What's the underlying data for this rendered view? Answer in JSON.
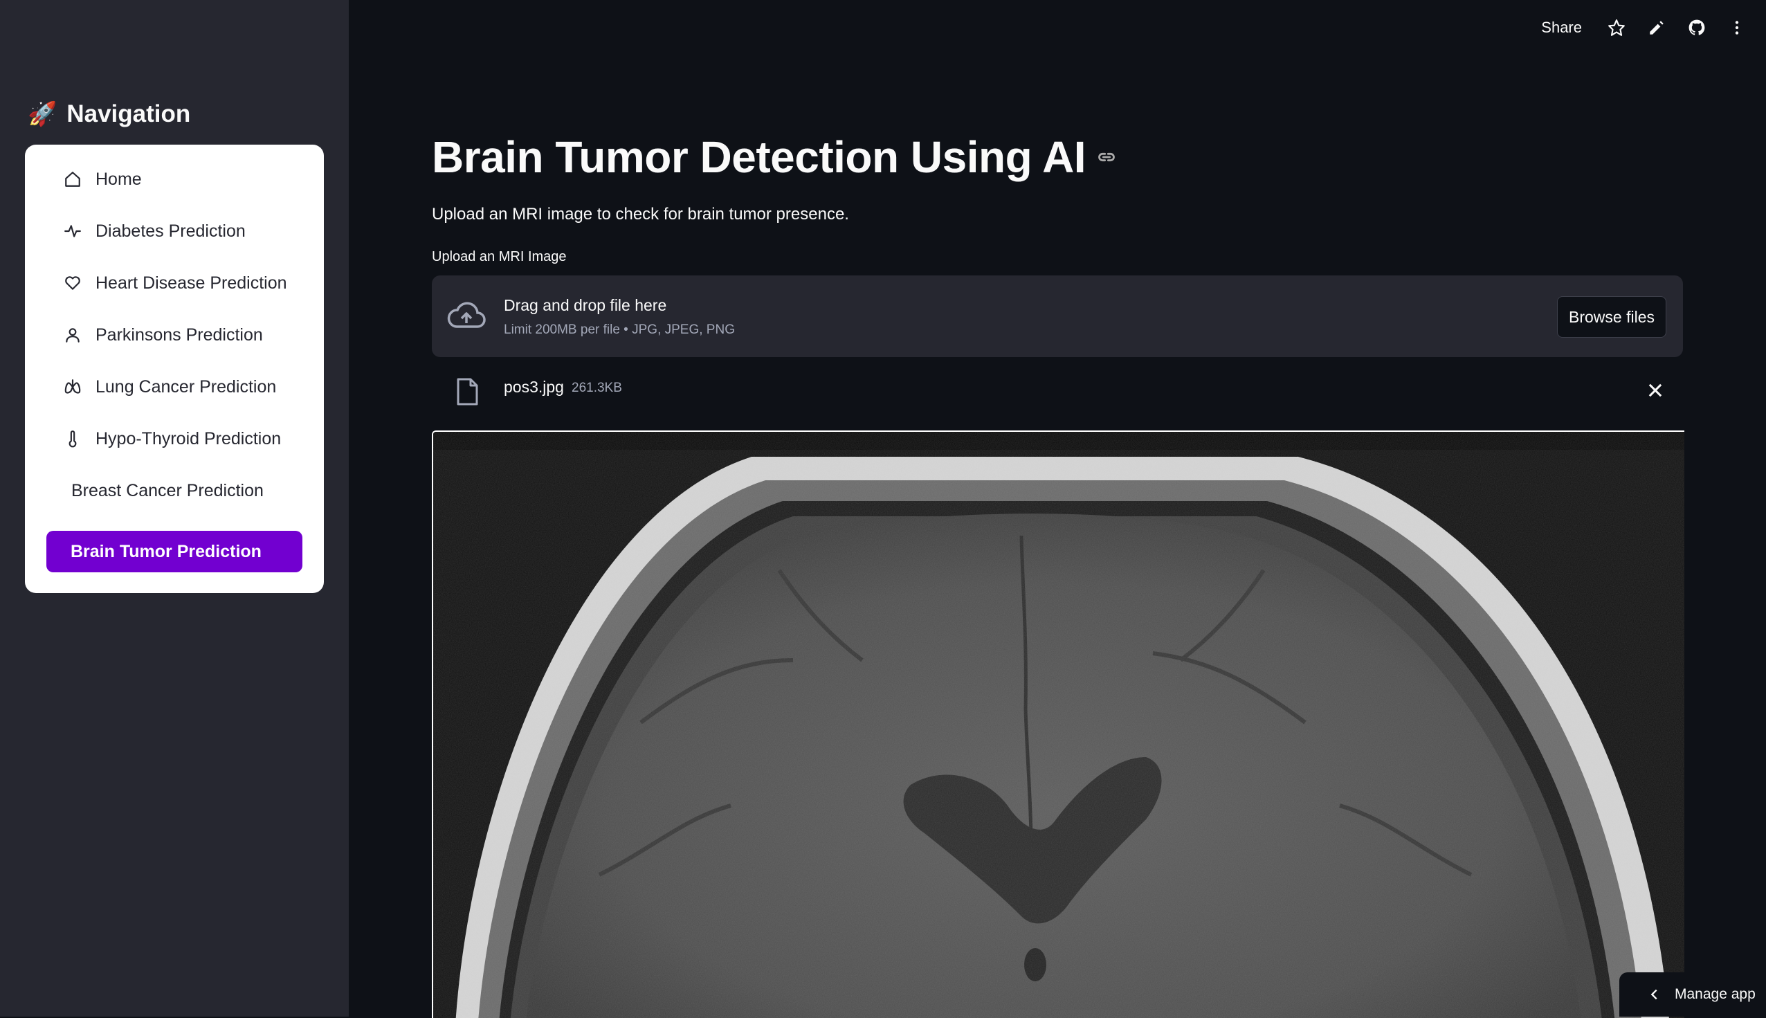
{
  "sidebar": {
    "title": "Navigation",
    "title_icon": "rocket-icon",
    "items": [
      {
        "label": "Home",
        "icon": "house-icon"
      },
      {
        "label": "Diabetes Prediction",
        "icon": "activity-icon"
      },
      {
        "label": "Heart Disease Prediction",
        "icon": "heart-icon"
      },
      {
        "label": "Parkinsons Prediction",
        "icon": "person-icon"
      },
      {
        "label": "Lung Cancer Prediction",
        "icon": "lungs-icon"
      },
      {
        "label": "Hypo-Thyroid Prediction",
        "icon": "thermometer-icon"
      },
      {
        "label": "Breast Cancer Prediction",
        "icon": ""
      },
      {
        "label": "Brain Tumor Prediction",
        "icon": "",
        "active": true
      }
    ],
    "active_color": "#7200d0"
  },
  "topbar": {
    "share_label": "Share",
    "icons": [
      "star-icon",
      "pencil-icon",
      "github-icon",
      "more-vertical-icon"
    ]
  },
  "main": {
    "title": "Brain Tumor Detection Using AI",
    "subtitle": "Upload an MRI image to check for brain tumor presence.",
    "uploader": {
      "label": "Upload an MRI Image",
      "drag_text": "Drag and drop file here",
      "limit_text": "Limit 200MB per file • JPG, JPEG, PNG",
      "browse_label": "Browse files"
    },
    "file": {
      "name": "pos3.jpg",
      "size": "261.3KB"
    }
  },
  "footer": {
    "manage_label": "Manage app"
  }
}
